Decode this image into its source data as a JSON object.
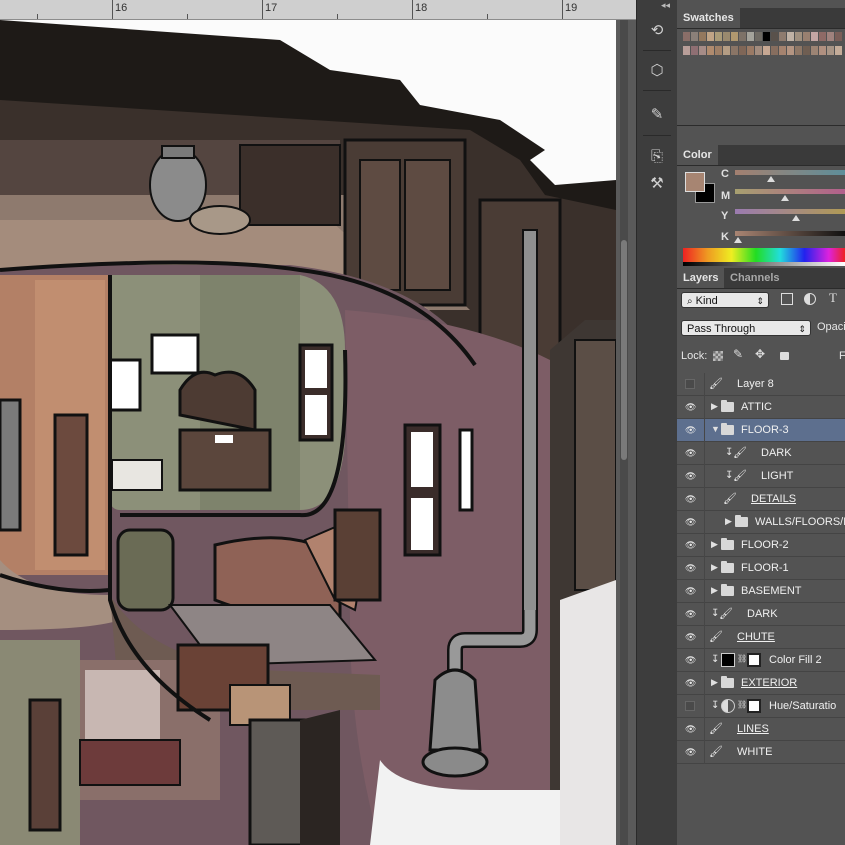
{
  "ruler": {
    "numbers": [
      "16",
      "17",
      "18",
      "19"
    ]
  },
  "tools": {
    "items": [
      "history-icon",
      "3d-icon",
      "brush-preset-icon",
      "clone-source-icon",
      "tool-preset-icon"
    ],
    "glyphs": [
      "⟲",
      "⬡",
      "✎",
      "⎘",
      "⚒"
    ]
  },
  "collapse": "◂◂",
  "swatches": {
    "tab": "Swatches",
    "colors": [
      "#8a6e68",
      "#8b8079",
      "#93785e",
      "#c0a486",
      "#aa9b78",
      "#9a8a6e",
      "#b0986f",
      "#7d7268",
      "#a4a39b",
      "#6e6a63",
      "#000000",
      "#59514b",
      "#8e7b6e",
      "#c0b2a5",
      "#a0907f",
      "#998070",
      "#c3a6a4",
      "#8e6a66",
      "#a0827d",
      "#7a5e58",
      "#b89e99",
      "#8f6f73",
      "#a68c87",
      "#b08b6e",
      "#9e7f66",
      "#b49d84",
      "#8a7566",
      "#7f6657",
      "#9a7a65",
      "#a28c7e",
      "#c7a893",
      "#876e5f",
      "#a5836f",
      "#b49582",
      "#8e7766",
      "#6f5e52",
      "#9c8474",
      "#b09080",
      "#a89586",
      "#c4ac99"
    ]
  },
  "color_panel": {
    "tab": "Color",
    "foreground": "#a78572",
    "background": "#000000",
    "sliders": [
      {
        "label": "C",
        "value": 0.34
      },
      {
        "label": "M",
        "value": 0.47
      },
      {
        "label": "Y",
        "value": 0.58
      },
      {
        "label": "K",
        "value": 0.03
      }
    ]
  },
  "layers_panel": {
    "tabs": [
      "Layers",
      "Channels"
    ],
    "filter_kind": "Kind",
    "filter_icons": [
      "image-filter-icon",
      "adjustment-filter-icon",
      "type-filter-icon"
    ],
    "blend_mode": "Pass Through",
    "opacity_label": "Opacit",
    "lock_label": "Lock:",
    "fill_label": "F",
    "layers": [
      {
        "name": "Layer 8",
        "visible": false,
        "type": "brush",
        "indent": 0,
        "selected": false,
        "underline": false
      },
      {
        "name": "ATTIC",
        "visible": true,
        "type": "group",
        "indent": 0,
        "expanded": false,
        "selected": false,
        "underline": false
      },
      {
        "name": "FLOOR-3",
        "visible": true,
        "type": "group",
        "indent": 0,
        "expanded": true,
        "selected": true,
        "underline": false
      },
      {
        "name": "DARK",
        "visible": true,
        "type": "brush",
        "indent": 1,
        "clipped": true,
        "selected": false,
        "underline": false
      },
      {
        "name": "LIGHT",
        "visible": true,
        "type": "brush",
        "indent": 1,
        "clipped": true,
        "selected": false,
        "underline": false
      },
      {
        "name": "DETAILS",
        "visible": true,
        "type": "brush",
        "indent": 1,
        "selected": false,
        "underline": true
      },
      {
        "name": "WALLS/FLOORS/D",
        "visible": true,
        "type": "group",
        "indent": 1,
        "expanded": false,
        "selected": false,
        "underline": false
      },
      {
        "name": "FLOOR-2",
        "visible": true,
        "type": "group",
        "indent": 0,
        "expanded": false,
        "selected": false,
        "underline": false
      },
      {
        "name": "FLOOR-1",
        "visible": true,
        "type": "group",
        "indent": 0,
        "expanded": false,
        "selected": false,
        "underline": false
      },
      {
        "name": "BASEMENT",
        "visible": true,
        "type": "group",
        "indent": 0,
        "expanded": false,
        "selected": false,
        "underline": false
      },
      {
        "name": "DARK",
        "visible": true,
        "type": "brush",
        "indent": 0,
        "clipped": true,
        "selected": false,
        "underline": false
      },
      {
        "name": "CHUTE",
        "visible": true,
        "type": "brush",
        "indent": 0,
        "selected": false,
        "underline": true
      },
      {
        "name": "Color Fill 2",
        "visible": true,
        "type": "fill",
        "indent": 0,
        "clipped": true,
        "selected": false,
        "underline": false
      },
      {
        "name": "EXTERIOR",
        "visible": true,
        "type": "group",
        "indent": 0,
        "expanded": false,
        "selected": false,
        "underline": true
      },
      {
        "name": "Hue/Saturatio",
        "visible": false,
        "type": "adjustment",
        "indent": 0,
        "clipped": true,
        "selected": false,
        "underline": false
      },
      {
        "name": "LINES",
        "visible": true,
        "type": "brush",
        "indent": 0,
        "selected": false,
        "underline": true
      },
      {
        "name": "WHITE",
        "visible": true,
        "type": "brush",
        "indent": 0,
        "selected": false,
        "underline": false
      }
    ]
  }
}
